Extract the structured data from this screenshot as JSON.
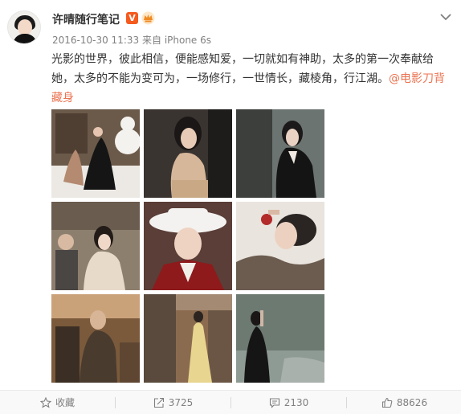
{
  "post": {
    "author": "许晴随行笔记",
    "verified_badge": "V",
    "timestamp": "2016-10-30 11:33",
    "via_label": "来自",
    "device": "iPhone 6s",
    "text": "光影的世界，彼此相信，便能感知爱，一切就如有神助，太多的第一次奉献给她，太多的不能为变可为，一场修行，一世情长，藏棱角，行江湖。",
    "mention": "@电影刀背藏身"
  },
  "actions": {
    "favorite_label": "收藏",
    "repost_count": "3725",
    "comment_count": "2130",
    "like_count": "88626"
  },
  "icons": {
    "menu": "chevron-down-icon",
    "favorite": "star-icon",
    "repost": "share-icon",
    "comment": "comment-icon",
    "like": "thumbs-up-icon"
  },
  "colors": {
    "accent": "#eb7350",
    "verified": "#f55a1e",
    "meta_text": "#808080"
  }
}
